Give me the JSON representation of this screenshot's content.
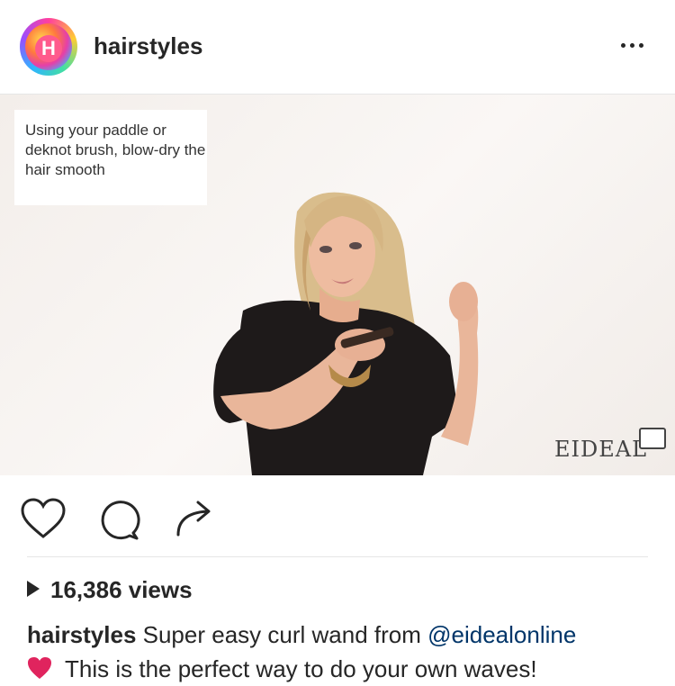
{
  "post": {
    "username": "hairstyles",
    "avatar_letter": "H",
    "more_icon": "more-horizontal-icon"
  },
  "media": {
    "overlay_text": "Using your paddle or deknot brush, blow-dry the hair smooth",
    "watermark": "EIDEAL"
  },
  "actions": {
    "like_icon": "heart-outline-icon",
    "comment_icon": "comment-bubble-icon",
    "share_icon": "share-arrow-icon"
  },
  "stats": {
    "views": "16,386 views",
    "play_icon": "play-triangle-icon"
  },
  "caption": {
    "author": "hairstyles",
    "text_before_mention": " Super easy curl wand from ",
    "mention": "@eidealonline",
    "emoji_icon": "red-heart-emoji-icon",
    "line2": "This is the perfect way to do your own waves!"
  },
  "colors": {
    "text": "#262626",
    "mention": "#003569",
    "divider": "#e6e6e6",
    "emoji_heart": "#e0245e"
  }
}
